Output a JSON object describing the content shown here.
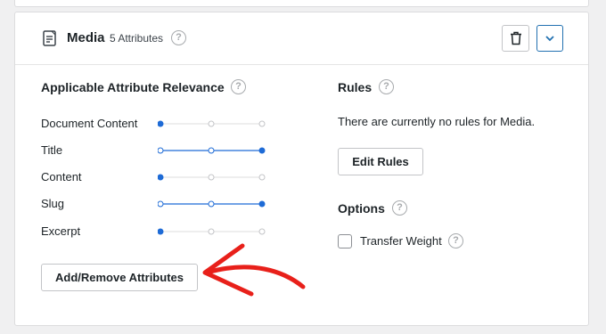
{
  "header": {
    "title": "Media",
    "attribute_count": "5 Attributes",
    "icons": {
      "document": "document-list-icon",
      "help": "help-icon",
      "delete": "trash-icon",
      "toggle": "chevron-down-icon"
    }
  },
  "relevance": {
    "title": "Applicable Attribute Relevance",
    "attributes": [
      {
        "label": "Document Content",
        "level": 1
      },
      {
        "label": "Title",
        "level": 3
      },
      {
        "label": "Content",
        "level": 1
      },
      {
        "label": "Slug",
        "level": 3
      },
      {
        "label": "Excerpt",
        "level": 1
      }
    ],
    "max_level": 3,
    "button_label": "Add/Remove Attributes"
  },
  "rules": {
    "title": "Rules",
    "empty_text": "There are currently no rules for Media.",
    "button_label": "Edit Rules"
  },
  "options": {
    "title": "Options",
    "transfer_weight_label": "Transfer Weight",
    "transfer_weight_checked": false
  },
  "colors": {
    "accent": "#2271b1",
    "slider_active": "#1e6bd6",
    "annotation_arrow": "#e8201a",
    "border": "#c3c4c7"
  }
}
